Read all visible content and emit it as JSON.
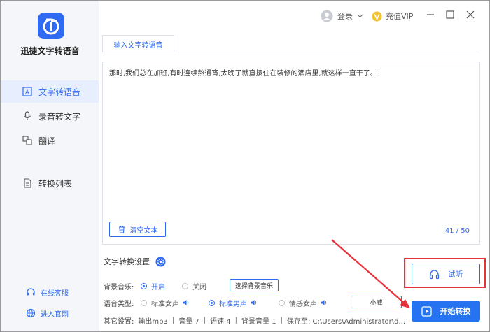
{
  "app": {
    "name": "迅捷文字转语音"
  },
  "sidebar": {
    "items": [
      {
        "label": "文字转语音",
        "icon": "text-to-speech-icon",
        "active": true
      },
      {
        "label": "录音转文字",
        "icon": "microphone-icon",
        "active": false
      },
      {
        "label": "翻译",
        "icon": "translate-icon",
        "active": false
      },
      {
        "label": "转换列表",
        "icon": "list-icon",
        "active": false
      }
    ],
    "links": [
      {
        "label": "在线客服",
        "icon": "headset-icon"
      },
      {
        "label": "进入官网",
        "icon": "globe-icon"
      }
    ]
  },
  "topbar": {
    "login_label": "登录",
    "vip_label": "充值VIP"
  },
  "tab": {
    "label": "输入文字转语音"
  },
  "editor": {
    "text": "那时,我们总在加班,有时连续熬通宵,太晚了就直接住在装修的酒店里,就这样一直干了。",
    "clear_label": "清空文本",
    "count": "41 / 50"
  },
  "settings": {
    "title": "文字转换设置",
    "music": {
      "label": "背景音乐:",
      "on_label": "开启",
      "off_label": "关闭",
      "selected": "on",
      "choose_label": "选择背景音乐"
    },
    "voice": {
      "label": "语音类型:",
      "options": [
        "标准女声",
        "标准男声",
        "情感女声"
      ],
      "selected_index": 1,
      "extra_button": "小威"
    },
    "other": {
      "label": "其它设置:",
      "items": [
        "输出mp3",
        "音量 7",
        "语速 4",
        "背景音量 1",
        "保存至: C:\\Users\\Administrator\\d..."
      ]
    }
  },
  "actions": {
    "listen_label": "试听",
    "convert_label": "开始转换"
  },
  "colors": {
    "accent": "#2f6bf2",
    "annotation": "#e8313b",
    "sidebar_bg": "#f4f6f9"
  }
}
